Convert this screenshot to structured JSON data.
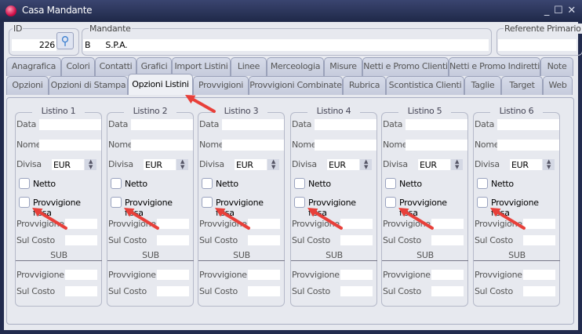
{
  "window": {
    "title": "Casa Mandante",
    "icons": [
      "minimize-icon",
      "maximize-icon",
      "close-icon"
    ]
  },
  "header": {
    "id_label": "ID",
    "id_value": "226",
    "mandante_label": "Mandante",
    "mandante_value": "B      S.P.A.",
    "referente_label": "Referente Primario",
    "referente_value": ""
  },
  "tabs_row1": [
    "Anagrafica",
    "Colori",
    "Contatti",
    "Grafici",
    "Import Listini",
    "Linee",
    "Merceologia",
    "Misure",
    "Netti e Promo Clienti",
    "Netti e Promo Indiretti",
    "Note"
  ],
  "tabs_row2": [
    "Opzioni",
    "Opzioni di Stampa",
    "Opzioni Listini",
    "Provvigioni",
    "Provvigioni Combinate",
    "Rubrica",
    "Scontistica Clienti",
    "Taglie",
    "Target",
    "Web"
  ],
  "selected_tab": "Opzioni Listini",
  "labels": {
    "data": "Data",
    "nome": "Nome",
    "divisa": "Divisa",
    "netto": "Netto",
    "provv_fissa": "Provvigione fissa",
    "provvigione": "Provvigione",
    "sul_costo": "Sul Costo",
    "sub": "SUB"
  },
  "listini": [
    {
      "title": "Listino 1",
      "divisa": "EUR"
    },
    {
      "title": "Listino 2",
      "divisa": "EUR"
    },
    {
      "title": "Listino 3",
      "divisa": "EUR"
    },
    {
      "title": "Listino 4",
      "divisa": "EUR"
    },
    {
      "title": "Listino 5",
      "divisa": "EUR"
    },
    {
      "title": "Listino 6",
      "divisa": "EUR"
    }
  ],
  "annotation_color": "#e8403a"
}
